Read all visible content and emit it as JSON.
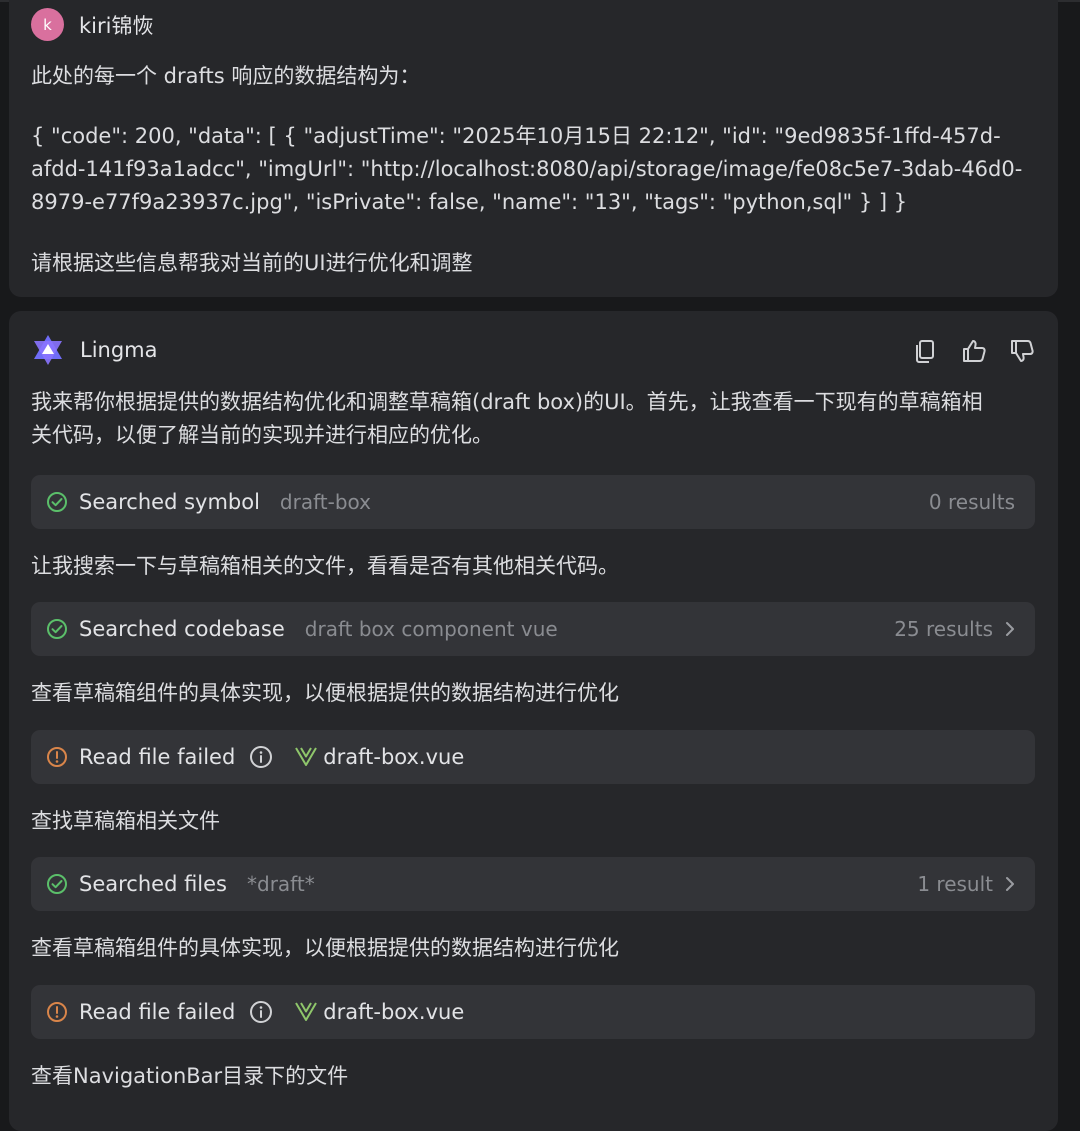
{
  "user": {
    "avatar_letter": "k",
    "name": "kiri锦恢",
    "intro": "此处的每一个 drafts 响应的数据结构为：",
    "json_line1": "{ \"code\": 200, \"data\": [ { \"adjustTime\": \"2025年10月15日 22:12\", \"id\": \"9ed9835f-1ffd-457d-",
    "json_line2": "afdd-141f93a1adcc\", \"imgUrl\": \"http://localhost:8080/api/storage/image/fe08c5e7-3dab-46d0-",
    "json_line3": "8979-e77f9a23937c.jpg\", \"isPrivate\": false, \"name\": \"13\", \"tags\": \"python,sql\" } ] }",
    "request": "请根据这些信息帮我对当前的UI进行优化和调整"
  },
  "assistant": {
    "name": "Lingma",
    "actions": {
      "copy": "copy-icon",
      "like": "thumbs-up-icon",
      "dislike": "thumbs-down-icon"
    },
    "intro_line1": "我来帮你根据提供的数据结构优化和调整草稿箱(draft box)的UI。首先，让我查看一下现有的草稿箱相",
    "intro_line2": "关代码，以便了解当前的实现并进行相应的优化。",
    "step1": {
      "title": "Searched symbol",
      "query": "draft-box",
      "count": "0 results"
    },
    "note1": "让我搜索一下与草稿箱相关的文件，看看是否有其他相关代码。",
    "step2": {
      "title": "Searched codebase",
      "query": "draft box component vue",
      "count": "25 results"
    },
    "note2": "查看草稿箱组件的具体实现，以便根据提供的数据结构进行优化",
    "step3": {
      "title": "Read file failed",
      "file": "draft-box.vue"
    },
    "note3": "查找草稿箱相关文件",
    "step4": {
      "title": "Searched files",
      "query": "*draft*",
      "count": "1 result"
    },
    "note4": "查看草稿箱组件的具体实现，以便根据提供的数据结构进行优化",
    "step5": {
      "title": "Read file failed",
      "file": "draft-box.vue"
    },
    "note5": "查看NavigationBar目录下的文件"
  },
  "colors": {
    "success": "#5bbf6a",
    "warning": "#d9854a",
    "vue_green": "#8fc66b",
    "avatar": "#d9709e"
  }
}
